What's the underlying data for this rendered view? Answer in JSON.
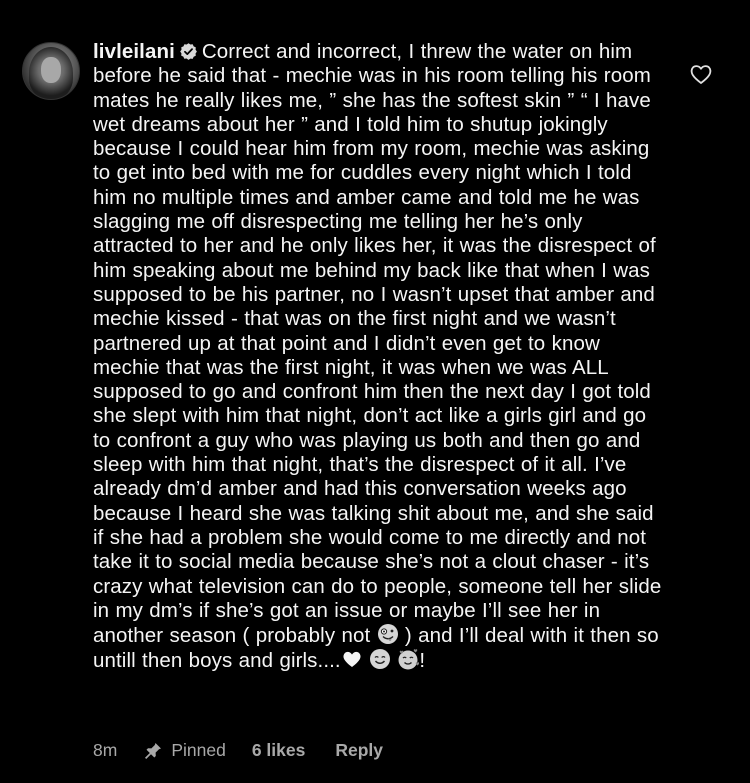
{
  "comment": {
    "username": "livleilani",
    "verified_icon": "verified-badge-icon",
    "text_part1": "Correct and incorrect, I threw the water on him before he said that - mechie was in his room telling his room mates he really likes me, ” she has the softest skin ” “ I have wet dreams about her ” and I told him to shutup jokingly because I could hear him from my room, mechie was asking to get into bed with me for cuddles every night which I told him no multiple times and amber came and told me he was slagging me off disrespecting me telling her he’s only attracted to her and he only likes her, it was the disrespect of him speaking about me behind my back like that when I was supposed to be his partner, no I wasn’t upset that amber and mechie kissed - that was on the first night and we wasn’t partnered up at that point and I didn’t even get to know mechie that was the first night, it was when we was ALL supposed to go and confront him then the next day I got told she slept with him that night, don’t act like a girls girl and go to confront a guy who was playing us both and then go and sleep with him that night, that’s the disrespect of it all. I’ve already dm’d amber and had this conversation weeks ago because I heard she was talking shit about me, and she said if she had a problem she would come to me directly and not take it to social media because she’s not a clout chaser - it’s crazy what television can do to people, someone tell her slide in my dm’s if she’s got an issue or maybe I’ll see her in another season ( probably not",
    "text_part2": ") and I’ll deal with it then so untill then boys and girls....",
    "text_end": "!",
    "emojis": [
      "zany-face-emoji",
      "white-heart-emoji",
      "smiling-face-emoji",
      "face-with-hearts-emoji"
    ]
  },
  "footer": {
    "time": "8m",
    "pinned_label": "Pinned",
    "likes": "6 likes",
    "reply": "Reply"
  },
  "icons": {
    "like": "heart-outline-icon",
    "pin": "pin-icon"
  }
}
